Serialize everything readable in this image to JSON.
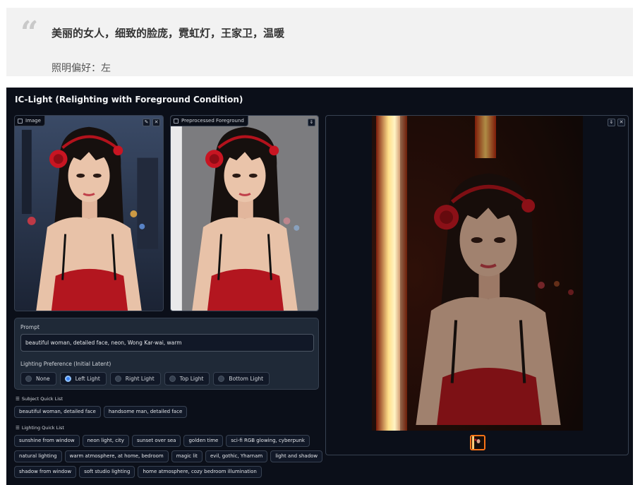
{
  "quote": {
    "mark": "“",
    "title": "美丽的女人，细致的脸庞，霓虹灯，王家卫，温暖",
    "subtitle": "照明偏好：左"
  },
  "app": {
    "title": "IC-Light (Relighting with Foreground Condition)",
    "image_panel": {
      "label": "Image",
      "edit_icon": "✎",
      "close_icon": "✕"
    },
    "fg_panel": {
      "label": "Preprocessed Foreground",
      "download_icon": "⇓"
    },
    "output_panel": {
      "download_icon": "⇓",
      "close_icon": "✕"
    },
    "prompt_label": "Prompt",
    "prompt_value": "beautiful woman, detailed face, neon, Wong Kar-wai, warm",
    "lighting_label": "Lighting Preference (Initial Latent)",
    "lighting_options": [
      {
        "label": "None",
        "selected": false
      },
      {
        "label": "Left Light",
        "selected": true
      },
      {
        "label": "Right Light",
        "selected": false
      },
      {
        "label": "Top Light",
        "selected": false
      },
      {
        "label": "Bottom Light",
        "selected": false
      }
    ],
    "subject_label": "Subject Quick List",
    "subject_items": [
      "beautiful woman, detailed face",
      "handsome man, detailed face"
    ],
    "lighting_quick_label": "Lighting Quick List",
    "lighting_rows": [
      [
        "sunshine from window",
        "neon light, city",
        "sunset over sea",
        "golden time",
        "sci-fi RGB glowing, cyberpunk"
      ],
      [
        "natural lighting",
        "warm atmosphere, at home, bedroom",
        "magic lit",
        "evil, gothic, Yharnam",
        "light and shadow"
      ],
      [
        "shadow from window",
        "soft studio lighting",
        "home atmosphere, cozy bedroom illumination"
      ]
    ]
  },
  "colors": {
    "accent": "#3b82f6",
    "app_bg": "#0b0f19",
    "panel_bg": "#1f2937",
    "thumb_border": "#f97316"
  }
}
